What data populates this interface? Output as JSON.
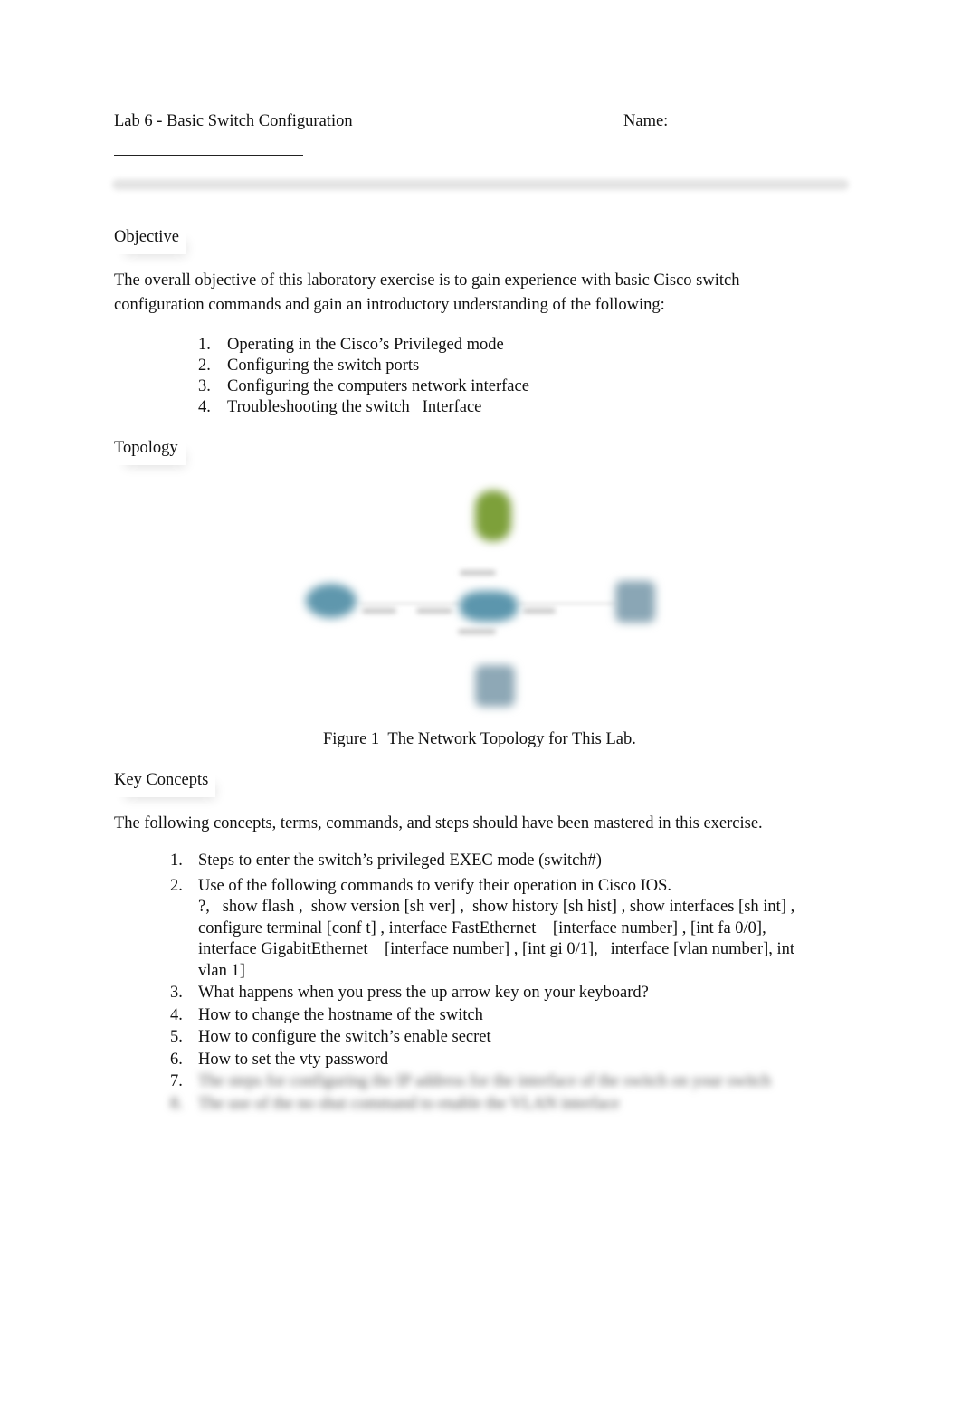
{
  "header": {
    "title": "Lab 6 - Basic Switch Configuration",
    "name_label": "Name:"
  },
  "objective": {
    "heading": "Objective",
    "paragraph": "The overall objective of this laboratory exercise is to gain experience with basic Cisco switch configuration commands and gain an introductory understanding of the following:",
    "items": [
      {
        "num": "1.",
        "text": "Operating in the Cisco’s Privileged mode"
      },
      {
        "num": "2.",
        "text": "Configuring the switch ports"
      },
      {
        "num": "3.",
        "text": "Configuring the computers network interface"
      },
      {
        "num": "4.",
        "text": "Troubleshooting the switch   Interface"
      }
    ]
  },
  "topology": {
    "heading": "Topology",
    "figure_caption": "Figure 1  The Network Topology for This Lab.",
    "nodes": [
      {
        "name": "server",
        "color": "#7da03a"
      },
      {
        "name": "router",
        "color": "#5f97ad"
      },
      {
        "name": "switch",
        "color": "#5c96ad"
      },
      {
        "name": "pc-right",
        "color": "#8aa6b5"
      },
      {
        "name": "pc-bottom",
        "color": "#8ea8b6"
      }
    ]
  },
  "key_concepts": {
    "heading": "Key Concepts",
    "paragraph": "The following concepts, terms, commands, and steps should have been mastered in this exercise.",
    "items": [
      {
        "num": "1.",
        "text": "Steps to enter the switch’s privileged EXEC mode (switch#)"
      },
      {
        "num": "2.",
        "text": "Use of the following commands to verify their operation in Cisco IOS.",
        "subtext": "?,   show flash ,  show version [sh ver] ,  show history [sh hist] , show interfaces [sh int] , configure terminal [conf t] , interface FastEthernet    [interface number] , [int fa 0/0], interface GigabitEthernet    [interface number] , [int gi 0/1],   interface [vlan number], int vlan 1]"
      },
      {
        "num": "3.",
        "text": "What happens when you press the up arrow key on your keyboard?"
      },
      {
        "num": "4.",
        "text": "How to change the hostname of the switch"
      },
      {
        "num": "5.",
        "text": "How to configure the switch’s enable secret"
      },
      {
        "num": "6.",
        "text": "How to set the vty password"
      },
      {
        "num": "7.",
        "text": "The steps for configuring the IP address for the interface of the switch on your switch",
        "blurred": true
      },
      {
        "num": "8.",
        "text": "The use of the no shut command to enable the VLAN interface",
        "blurred": true
      }
    ]
  }
}
